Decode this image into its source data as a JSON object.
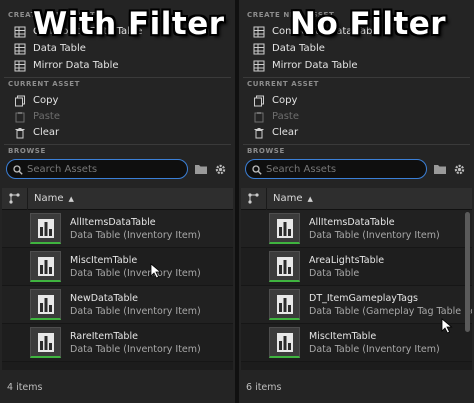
{
  "panels": [
    {
      "overlay_title": "With Filter",
      "sections": {
        "create": "CREATE NEW ASSET",
        "current": "CURRENT ASSET",
        "browse": "BROWSE"
      },
      "create_items": [
        {
          "label": "Composite Data Table",
          "icon": "composite-table-icon"
        },
        {
          "label": "Data Table",
          "icon": "data-table-icon"
        },
        {
          "label": "Mirror Data Table",
          "icon": "mirror-table-icon"
        }
      ],
      "current_items": [
        {
          "label": "Copy",
          "icon": "copy-icon"
        },
        {
          "label": "Paste",
          "icon": "paste-icon"
        },
        {
          "label": "Clear",
          "icon": "trash-icon"
        }
      ],
      "search": {
        "placeholder": "Search Assets",
        "value": ""
      },
      "list_header": {
        "name": "Name"
      },
      "rows": [
        {
          "name": "AllItemsDataTable",
          "type": "Data Table (Inventory Item)"
        },
        {
          "name": "MiscItemTable",
          "type": "Data Table (Inventory Item)"
        },
        {
          "name": "NewDataTable",
          "type": "Data Table (Inventory Item)"
        },
        {
          "name": "RareItemTable",
          "type": "Data Table (Inventory Item)"
        }
      ],
      "footer": "4 items"
    },
    {
      "overlay_title": "No Filter",
      "sections": {
        "create": "CREATE NEW ASSET",
        "current": "CURRENT ASSET",
        "browse": "BROWSE"
      },
      "create_items": [
        {
          "label": "Composite Data Table",
          "icon": "composite-table-icon"
        },
        {
          "label": "Data Table",
          "icon": "data-table-icon"
        },
        {
          "label": "Mirror Data Table",
          "icon": "mirror-table-icon"
        }
      ],
      "current_items": [
        {
          "label": "Copy",
          "icon": "copy-icon"
        },
        {
          "label": "Paste",
          "icon": "paste-icon"
        },
        {
          "label": "Clear",
          "icon": "trash-icon"
        }
      ],
      "search": {
        "placeholder": "Search Assets",
        "value": ""
      },
      "list_header": {
        "name": "Name"
      },
      "rows": [
        {
          "name": "AllItemsDataTable",
          "type": "Data Table (Inventory Item)"
        },
        {
          "name": "AreaLightsTable",
          "type": "Data Table"
        },
        {
          "name": "DT_ItemGameplayTags",
          "type": "Data Table (Gameplay Tag Table Row)"
        },
        {
          "name": "MiscItemTable",
          "type": "Data Table (Inventory Item)"
        }
      ],
      "footer": "6 items"
    }
  ],
  "colors": {
    "accent": "#3b7fd6",
    "thumb_bar": "#3fb43f",
    "background": "#242424"
  }
}
